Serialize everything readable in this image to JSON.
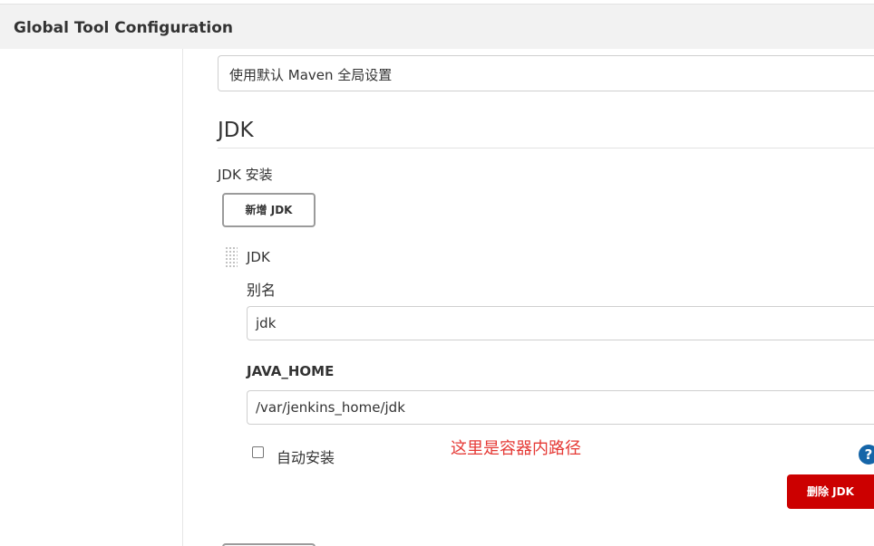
{
  "header": {
    "title": "Global Tool Configuration"
  },
  "maven": {
    "global_settings_value": "使用默认 Maven 全局设置"
  },
  "jdk_section": {
    "heading": "JDK",
    "installations_label": "JDK 安装",
    "add_button_label": "新增 JDK",
    "installation": {
      "block_title": "JDK",
      "alias_label": "别名",
      "alias_value": "jdk",
      "java_home_label": "JAVA_HOME",
      "java_home_value": "/var/jenkins_home/jdk",
      "auto_install_label": "自动安装",
      "auto_install_checked": false,
      "help_icon": "?",
      "delete_button_label": "删除 JDK"
    }
  },
  "annotation": {
    "text": "这里是容器内路径",
    "color": "#e53935"
  },
  "colors": {
    "delete_button": "#cc0000",
    "help_icon": "#1565a8",
    "title_bar": "#f2f2f2"
  }
}
